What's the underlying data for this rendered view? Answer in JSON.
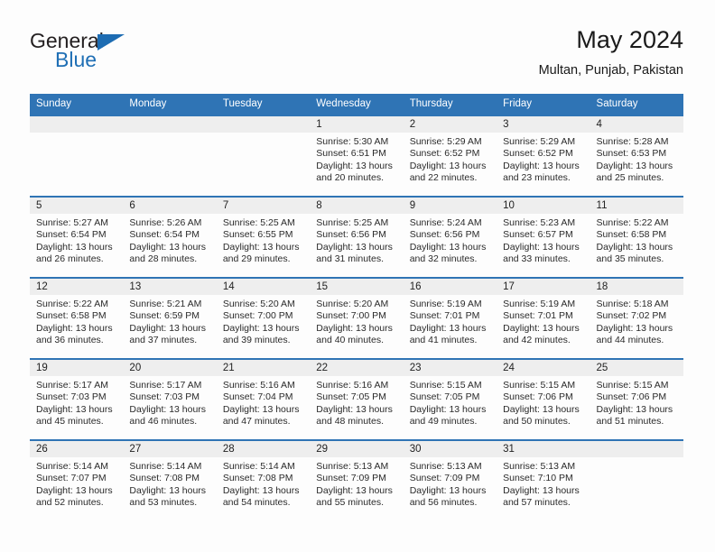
{
  "brand": {
    "line1": "General",
    "line2": "Blue",
    "triangle_icon": "brand-triangle-icon",
    "accent_color": "#1d6cb2"
  },
  "header": {
    "title": "May 2024",
    "subtitle": "Multan, Punjab, Pakistan"
  },
  "theme": {
    "header_blue": "#2f74b5",
    "daynum_gray": "#eeeeee",
    "page_background": "#fdfdfd",
    "text": "#222222"
  },
  "calendar": {
    "weekday_headers": [
      "Sunday",
      "Monday",
      "Tuesday",
      "Wednesday",
      "Thursday",
      "Friday",
      "Saturday"
    ],
    "weeks": [
      [
        {
          "day": "",
          "sunrise": "",
          "sunset": "",
          "daylight_line1": "",
          "daylight_line2": "",
          "empty": true
        },
        {
          "day": "",
          "sunrise": "",
          "sunset": "",
          "daylight_line1": "",
          "daylight_line2": "",
          "empty": true
        },
        {
          "day": "",
          "sunrise": "",
          "sunset": "",
          "daylight_line1": "",
          "daylight_line2": "",
          "empty": true
        },
        {
          "day": "1",
          "sunrise": "Sunrise: 5:30 AM",
          "sunset": "Sunset: 6:51 PM",
          "daylight_line1": "Daylight: 13 hours",
          "daylight_line2": "and 20 minutes.",
          "empty": false
        },
        {
          "day": "2",
          "sunrise": "Sunrise: 5:29 AM",
          "sunset": "Sunset: 6:52 PM",
          "daylight_line1": "Daylight: 13 hours",
          "daylight_line2": "and 22 minutes.",
          "empty": false
        },
        {
          "day": "3",
          "sunrise": "Sunrise: 5:29 AM",
          "sunset": "Sunset: 6:52 PM",
          "daylight_line1": "Daylight: 13 hours",
          "daylight_line2": "and 23 minutes.",
          "empty": false
        },
        {
          "day": "4",
          "sunrise": "Sunrise: 5:28 AM",
          "sunset": "Sunset: 6:53 PM",
          "daylight_line1": "Daylight: 13 hours",
          "daylight_line2": "and 25 minutes.",
          "empty": false
        }
      ],
      [
        {
          "day": "5",
          "sunrise": "Sunrise: 5:27 AM",
          "sunset": "Sunset: 6:54 PM",
          "daylight_line1": "Daylight: 13 hours",
          "daylight_line2": "and 26 minutes.",
          "empty": false
        },
        {
          "day": "6",
          "sunrise": "Sunrise: 5:26 AM",
          "sunset": "Sunset: 6:54 PM",
          "daylight_line1": "Daylight: 13 hours",
          "daylight_line2": "and 28 minutes.",
          "empty": false
        },
        {
          "day": "7",
          "sunrise": "Sunrise: 5:25 AM",
          "sunset": "Sunset: 6:55 PM",
          "daylight_line1": "Daylight: 13 hours",
          "daylight_line2": "and 29 minutes.",
          "empty": false
        },
        {
          "day": "8",
          "sunrise": "Sunrise: 5:25 AM",
          "sunset": "Sunset: 6:56 PM",
          "daylight_line1": "Daylight: 13 hours",
          "daylight_line2": "and 31 minutes.",
          "empty": false
        },
        {
          "day": "9",
          "sunrise": "Sunrise: 5:24 AM",
          "sunset": "Sunset: 6:56 PM",
          "daylight_line1": "Daylight: 13 hours",
          "daylight_line2": "and 32 minutes.",
          "empty": false
        },
        {
          "day": "10",
          "sunrise": "Sunrise: 5:23 AM",
          "sunset": "Sunset: 6:57 PM",
          "daylight_line1": "Daylight: 13 hours",
          "daylight_line2": "and 33 minutes.",
          "empty": false
        },
        {
          "day": "11",
          "sunrise": "Sunrise: 5:22 AM",
          "sunset": "Sunset: 6:58 PM",
          "daylight_line1": "Daylight: 13 hours",
          "daylight_line2": "and 35 minutes.",
          "empty": false
        }
      ],
      [
        {
          "day": "12",
          "sunrise": "Sunrise: 5:22 AM",
          "sunset": "Sunset: 6:58 PM",
          "daylight_line1": "Daylight: 13 hours",
          "daylight_line2": "and 36 minutes.",
          "empty": false
        },
        {
          "day": "13",
          "sunrise": "Sunrise: 5:21 AM",
          "sunset": "Sunset: 6:59 PM",
          "daylight_line1": "Daylight: 13 hours",
          "daylight_line2": "and 37 minutes.",
          "empty": false
        },
        {
          "day": "14",
          "sunrise": "Sunrise: 5:20 AM",
          "sunset": "Sunset: 7:00 PM",
          "daylight_line1": "Daylight: 13 hours",
          "daylight_line2": "and 39 minutes.",
          "empty": false
        },
        {
          "day": "15",
          "sunrise": "Sunrise: 5:20 AM",
          "sunset": "Sunset: 7:00 PM",
          "daylight_line1": "Daylight: 13 hours",
          "daylight_line2": "and 40 minutes.",
          "empty": false
        },
        {
          "day": "16",
          "sunrise": "Sunrise: 5:19 AM",
          "sunset": "Sunset: 7:01 PM",
          "daylight_line1": "Daylight: 13 hours",
          "daylight_line2": "and 41 minutes.",
          "empty": false
        },
        {
          "day": "17",
          "sunrise": "Sunrise: 5:19 AM",
          "sunset": "Sunset: 7:01 PM",
          "daylight_line1": "Daylight: 13 hours",
          "daylight_line2": "and 42 minutes.",
          "empty": false
        },
        {
          "day": "18",
          "sunrise": "Sunrise: 5:18 AM",
          "sunset": "Sunset: 7:02 PM",
          "daylight_line1": "Daylight: 13 hours",
          "daylight_line2": "and 44 minutes.",
          "empty": false
        }
      ],
      [
        {
          "day": "19",
          "sunrise": "Sunrise: 5:17 AM",
          "sunset": "Sunset: 7:03 PM",
          "daylight_line1": "Daylight: 13 hours",
          "daylight_line2": "and 45 minutes.",
          "empty": false
        },
        {
          "day": "20",
          "sunrise": "Sunrise: 5:17 AM",
          "sunset": "Sunset: 7:03 PM",
          "daylight_line1": "Daylight: 13 hours",
          "daylight_line2": "and 46 minutes.",
          "empty": false
        },
        {
          "day": "21",
          "sunrise": "Sunrise: 5:16 AM",
          "sunset": "Sunset: 7:04 PM",
          "daylight_line1": "Daylight: 13 hours",
          "daylight_line2": "and 47 minutes.",
          "empty": false
        },
        {
          "day": "22",
          "sunrise": "Sunrise: 5:16 AM",
          "sunset": "Sunset: 7:05 PM",
          "daylight_line1": "Daylight: 13 hours",
          "daylight_line2": "and 48 minutes.",
          "empty": false
        },
        {
          "day": "23",
          "sunrise": "Sunrise: 5:15 AM",
          "sunset": "Sunset: 7:05 PM",
          "daylight_line1": "Daylight: 13 hours",
          "daylight_line2": "and 49 minutes.",
          "empty": false
        },
        {
          "day": "24",
          "sunrise": "Sunrise: 5:15 AM",
          "sunset": "Sunset: 7:06 PM",
          "daylight_line1": "Daylight: 13 hours",
          "daylight_line2": "and 50 minutes.",
          "empty": false
        },
        {
          "day": "25",
          "sunrise": "Sunrise: 5:15 AM",
          "sunset": "Sunset: 7:06 PM",
          "daylight_line1": "Daylight: 13 hours",
          "daylight_line2": "and 51 minutes.",
          "empty": false
        }
      ],
      [
        {
          "day": "26",
          "sunrise": "Sunrise: 5:14 AM",
          "sunset": "Sunset: 7:07 PM",
          "daylight_line1": "Daylight: 13 hours",
          "daylight_line2": "and 52 minutes.",
          "empty": false
        },
        {
          "day": "27",
          "sunrise": "Sunrise: 5:14 AM",
          "sunset": "Sunset: 7:08 PM",
          "daylight_line1": "Daylight: 13 hours",
          "daylight_line2": "and 53 minutes.",
          "empty": false
        },
        {
          "day": "28",
          "sunrise": "Sunrise: 5:14 AM",
          "sunset": "Sunset: 7:08 PM",
          "daylight_line1": "Daylight: 13 hours",
          "daylight_line2": "and 54 minutes.",
          "empty": false
        },
        {
          "day": "29",
          "sunrise": "Sunrise: 5:13 AM",
          "sunset": "Sunset: 7:09 PM",
          "daylight_line1": "Daylight: 13 hours",
          "daylight_line2": "and 55 minutes.",
          "empty": false
        },
        {
          "day": "30",
          "sunrise": "Sunrise: 5:13 AM",
          "sunset": "Sunset: 7:09 PM",
          "daylight_line1": "Daylight: 13 hours",
          "daylight_line2": "and 56 minutes.",
          "empty": false
        },
        {
          "day": "31",
          "sunrise": "Sunrise: 5:13 AM",
          "sunset": "Sunset: 7:10 PM",
          "daylight_line1": "Daylight: 13 hours",
          "daylight_line2": "and 57 minutes.",
          "empty": false
        },
        {
          "day": "",
          "sunrise": "",
          "sunset": "",
          "daylight_line1": "",
          "daylight_line2": "",
          "empty": true
        }
      ]
    ]
  }
}
